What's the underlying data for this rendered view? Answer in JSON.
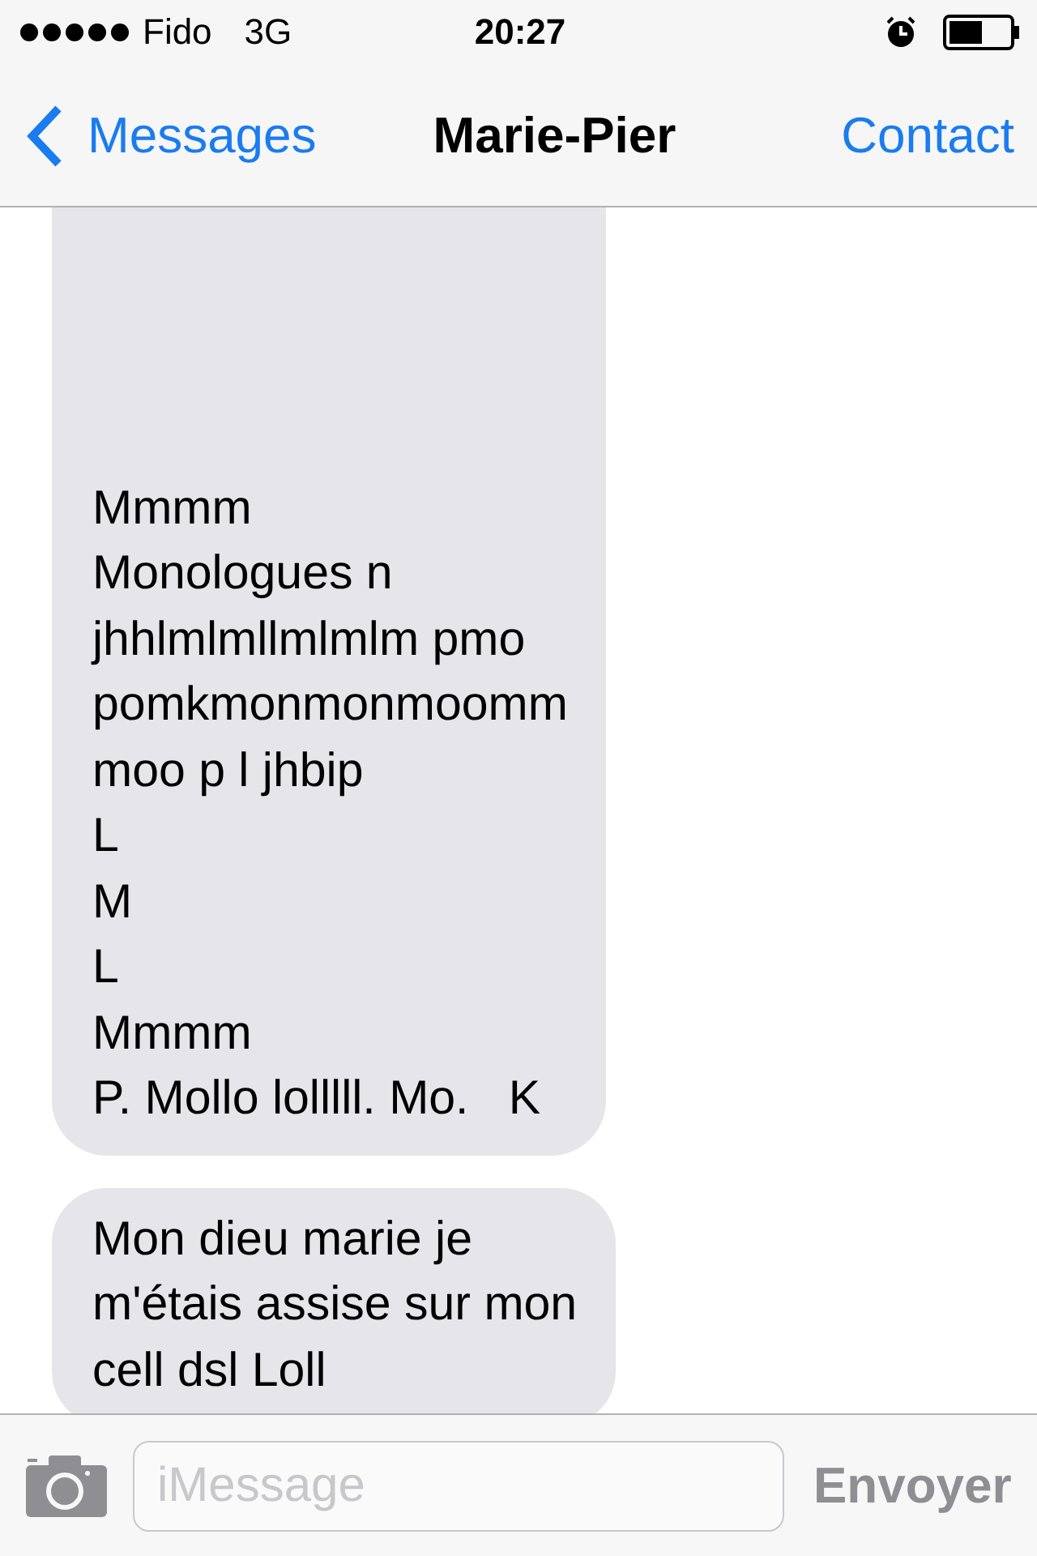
{
  "status_bar": {
    "carrier": "Fido",
    "network": "3G",
    "time": "20:27"
  },
  "nav": {
    "back": "Messages",
    "title": "Marie-Pier",
    "action": "Contact"
  },
  "messages": [
    {
      "kind": "received",
      "lines": [
        "Mmmm",
        "Monologues n",
        "jhhlmlmllmlmlm pmo",
        "pomkmonmonmoomm",
        "moo p l jhbip",
        "L",
        "M",
        "L",
        "Mmmm",
        "P. Mollo lolllll. Mo.   K"
      ]
    },
    {
      "kind": "received",
      "lines": [
        "Mon dieu marie je",
        "m'étais assise sur mon",
        "cell dsl Loll"
      ]
    }
  ],
  "composer": {
    "placeholder": "iMessage",
    "send": "Envoyer"
  }
}
